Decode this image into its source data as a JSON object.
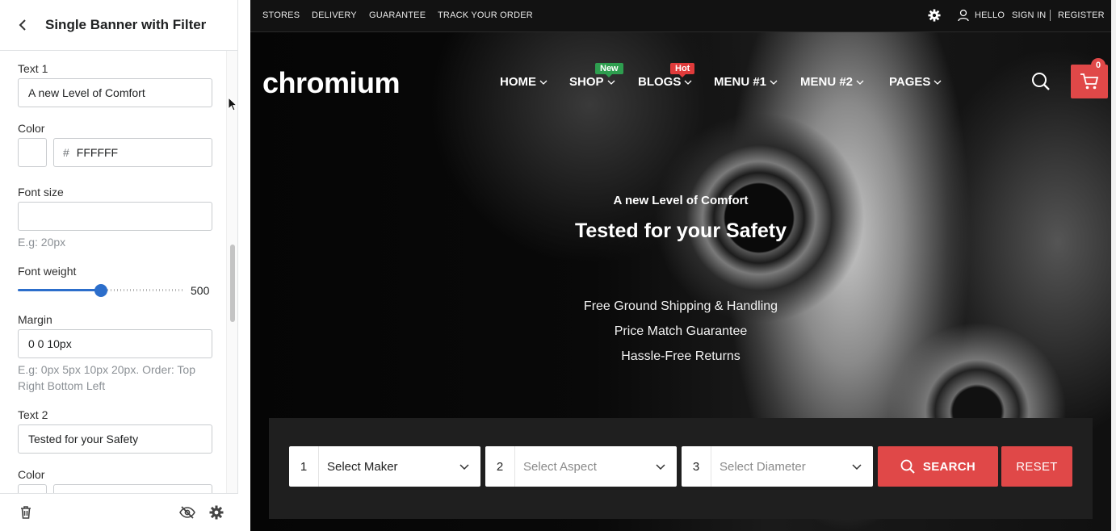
{
  "editor": {
    "title": "Single Banner with Filter",
    "text1_label": "Text 1",
    "text1_value": "A new Level of Comfort",
    "color1_label": "Color",
    "color1_hash": "#",
    "color1_value": "FFFFFF",
    "fontsize_label": "Font size",
    "fontsize_value": "",
    "fontsize_hint": "E.g: 20px",
    "fontweight_label": "Font weight",
    "fontweight_value": "500",
    "fontweight_fraction": 0.5,
    "margin_label": "Margin",
    "margin_value": "0 0 10px",
    "margin_hint": "E.g: 0px 5px 10px 20px. Order: Top Right Bottom Left",
    "text2_label": "Text 2",
    "text2_value": "Tested for your Safety",
    "color2_label": "Color"
  },
  "footer_icons": [
    "trash-icon",
    "eye-off-icon",
    "gear-icon"
  ],
  "store": {
    "topbar_links": [
      "STORES",
      "DELIVERY",
      "GUARANTEE",
      "TRACK YOUR ORDER"
    ],
    "hello": "HELLO",
    "sign_in": "SIGN IN",
    "register": "REGISTER",
    "logo": "chromium",
    "nav": [
      "HOME",
      "SHOP",
      "BLOGS",
      "MENU #1",
      "MENU #2",
      "PAGES"
    ],
    "badge_new": "New",
    "badge_hot": "Hot",
    "badge_new_color": "#2e9e4f",
    "badge_hot_color": "#e03b3b",
    "cart_count": "0",
    "accent": "#e04848"
  },
  "hero": {
    "text1": "A new Level of Comfort",
    "text2": "Tested for your Safety",
    "bullets": [
      "Free Ground Shipping & Handling",
      "Price Match Guarantee",
      "Hassle-Free Returns"
    ]
  },
  "filter": {
    "select1_num": "1",
    "select1": "Select Maker",
    "select2_num": "2",
    "select2": "Select Aspect",
    "select3_num": "3",
    "select3": "Select Diameter",
    "search": "SEARCH",
    "reset": "RESET"
  }
}
